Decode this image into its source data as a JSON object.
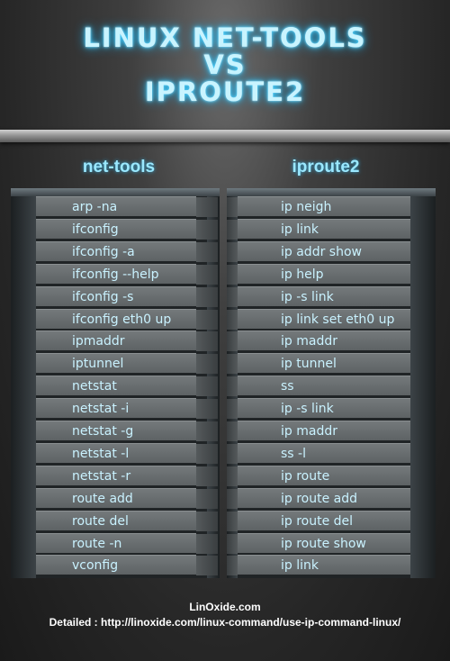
{
  "title": {
    "line1": "LINUX NET-TOOLS",
    "line2": "VS",
    "line3": "IPROUTE2"
  },
  "columns": {
    "left_header": "net-tools",
    "right_header": "iproute2"
  },
  "rows": [
    {
      "net_tools": "arp -na",
      "iproute2": "ip neigh"
    },
    {
      "net_tools": "ifconfig",
      "iproute2": "ip link"
    },
    {
      "net_tools": "ifconfig -a",
      "iproute2": "ip addr show"
    },
    {
      "net_tools": "ifconfig --help",
      "iproute2": "ip help"
    },
    {
      "net_tools": "ifconfig -s",
      "iproute2": "ip -s link"
    },
    {
      "net_tools": "ifconfig eth0 up",
      "iproute2": "ip link set eth0 up"
    },
    {
      "net_tools": "ipmaddr",
      "iproute2": "ip maddr"
    },
    {
      "net_tools": "iptunnel",
      "iproute2": "ip tunnel"
    },
    {
      "net_tools": "netstat",
      "iproute2": "ss"
    },
    {
      "net_tools": "netstat -i",
      "iproute2": "ip -s link"
    },
    {
      "net_tools": "netstat  -g",
      "iproute2": "ip maddr"
    },
    {
      "net_tools": "netstat -l",
      "iproute2": "ss -l"
    },
    {
      "net_tools": "netstat -r",
      "iproute2": "ip route"
    },
    {
      "net_tools": "route add",
      "iproute2": "ip route add"
    },
    {
      "net_tools": "route del",
      "iproute2": "ip route del"
    },
    {
      "net_tools": "route -n",
      "iproute2": "ip route show"
    },
    {
      "net_tools": "vconfig",
      "iproute2": "ip link"
    }
  ],
  "footer": {
    "site": "LinOxide.com",
    "detail": "Detailed : http://linoxide.com/linux-command/use-ip-command-linux/"
  }
}
